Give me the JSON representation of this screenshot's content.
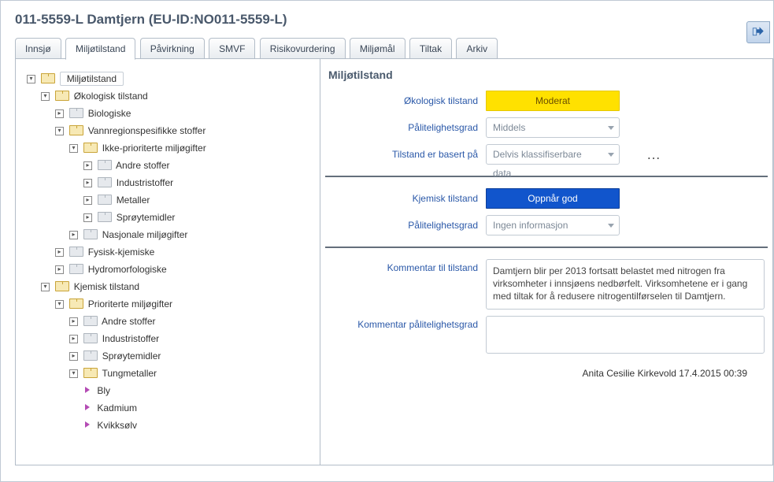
{
  "title": "011-5559-L Damtjern (EU-ID:NO011-5559-L)",
  "tabs": [
    "Innsjø",
    "Miljøtilstand",
    "Påvirkning",
    "SMVF",
    "Risikovurdering",
    "Miljømål",
    "Tiltak",
    "Arkiv"
  ],
  "active_tab_index": 1,
  "tree": {
    "root": "Miljøtilstand",
    "okologisk": "Økologisk tilstand",
    "biologiske": "Biologiske",
    "vannregion": "Vannregionspesifikke stoffer",
    "ikke_prioriterte": "Ikke-prioriterte miljøgifter",
    "andre_stoffer": "Andre stoffer",
    "industristoffer": "Industristoffer",
    "metaller": "Metaller",
    "sproytemidler": "Sprøytemidler",
    "nasjonale": "Nasjonale miljøgifter",
    "fysisk_kjem": "Fysisk-kjemiske",
    "hydromorf": "Hydromorfologiske",
    "kjemisk": "Kjemisk tilstand",
    "prioriterte": "Prioriterte miljøgifter",
    "andre_stoffer2": "Andre stoffer",
    "industristoffer2": "Industristoffer",
    "sproytemidler2": "Sprøytemidler",
    "tungmetaller": "Tungmetaller",
    "bly": "Bly",
    "kadmium": "Kadmium",
    "kvikksolv": "Kvikksølv"
  },
  "form": {
    "section": "Miljøtilstand",
    "okologisk_label": "Økologisk tilstand",
    "okologisk_value": "Moderat",
    "palitelighet1_label": "Pålitelighetsgrad",
    "palitelighet1_value": "Middels",
    "basert_label": "Tilstand er basert på",
    "basert_value": "Delvis klassifiserbare data",
    "kjemisk_label": "Kjemisk tilstand",
    "kjemisk_value": "Oppnår god",
    "palitelighet2_label": "Pålitelighetsgrad",
    "palitelighet2_value": "Ingen informasjon",
    "kommentar_tilstand_label": "Kommentar til tilstand",
    "kommentar_tilstand_value": "Damtjern blir per 2013 fortsatt belastet med nitrogen fra virksomheter i innsjøens nedbørfelt. Virksomhetene er i gang med tiltak for å redusere nitrogentilførselen til Damtjern.",
    "kommentar_palitelighet_label": "Kommentar pålitelighetsgrad",
    "kommentar_palitelighet_value": "",
    "signature": "Anita Cesilie Kirkevold 17.4.2015 00:39"
  }
}
